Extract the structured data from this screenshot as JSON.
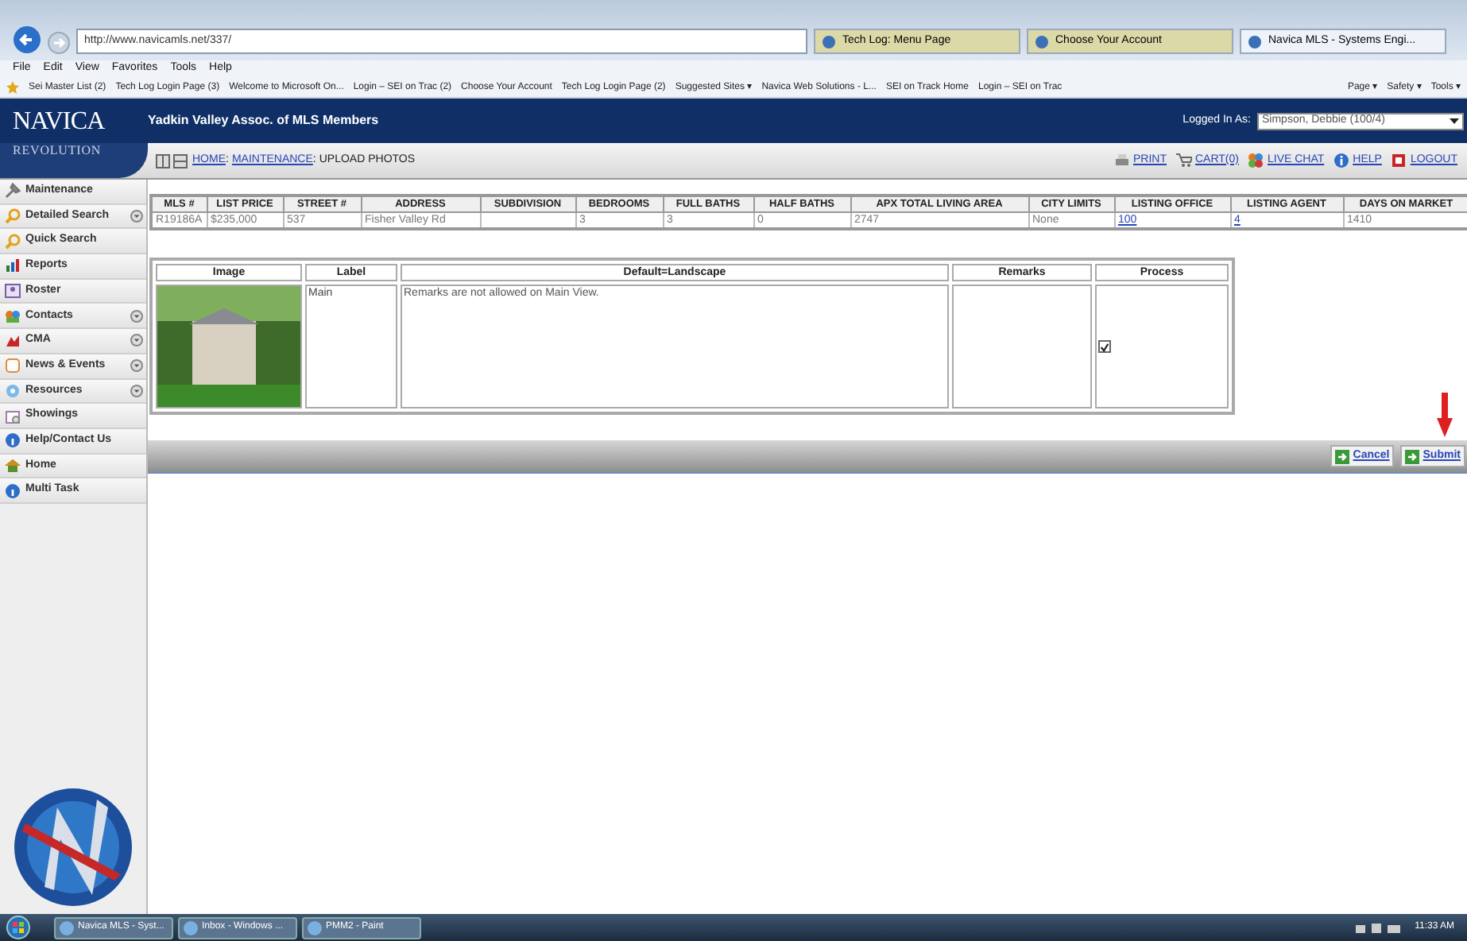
{
  "browser": {
    "address": "http://www.navicamls.net/337/",
    "tabs": [
      {
        "label": "Tech Log: Menu Page",
        "selected": false
      },
      {
        "label": "Choose Your Account",
        "selected": false
      },
      {
        "label": "Navica MLS - Systems Engi...",
        "selected": true
      }
    ],
    "menu": [
      "File",
      "Edit",
      "View",
      "Favorites",
      "Tools",
      "Help"
    ],
    "favorites": [
      "Sei Master List (2)",
      "Tech Log Login Page (3)",
      "Welcome to Microsoft On...",
      "Login – SEI on Trac (2)",
      "Choose Your Account",
      "Tech Log Login Page (2)",
      "Suggested Sites ▾",
      "Navica Web Solutions - L...",
      "SEI on Track Home",
      "Login – SEI on Trac"
    ],
    "commands": [
      "Page ▾",
      "Safety ▾",
      "Tools ▾"
    ]
  },
  "header": {
    "logo_top": "NAVICA",
    "logo_bottom": "REVOLUTION",
    "organization": "Yadkin Valley Assoc. of MLS Members",
    "logged_in_label": "Logged In As:",
    "user": "Simpson, Debbie (100/4)"
  },
  "breadcrumb": {
    "separator": ":",
    "items": [
      {
        "label": "HOME",
        "kind": "link"
      },
      {
        "label": "MAINTENANCE",
        "kind": "link"
      },
      {
        "label": "UPLOAD PHOTOS",
        "kind": "current"
      }
    ]
  },
  "top_links": [
    "PRINT",
    "CART(0)",
    "LIVE CHAT",
    "HELP",
    "LOGOUT"
  ],
  "sidebar": {
    "items": [
      {
        "label": "Maintenance",
        "expandable": false
      },
      {
        "label": "Detailed Search",
        "expandable": true
      },
      {
        "label": "Quick Search",
        "expandable": false
      },
      {
        "label": "Reports",
        "expandable": false
      },
      {
        "label": "Roster",
        "expandable": false
      },
      {
        "label": "Contacts",
        "expandable": true
      },
      {
        "label": "CMA",
        "expandable": true
      },
      {
        "label": "News & Events",
        "expandable": true
      },
      {
        "label": "Resources",
        "expandable": true
      },
      {
        "label": "Showings",
        "expandable": false
      },
      {
        "label": "Help/Contact Us",
        "expandable": false
      },
      {
        "label": "Home",
        "expandable": false
      },
      {
        "label": "Multi Task",
        "expandable": false
      }
    ]
  },
  "listing": {
    "columns": [
      "MLS #",
      "LIST PRICE",
      "STREET #",
      "ADDRESS",
      "SUBDIVISION",
      "BEDROOMS",
      "FULL BATHS",
      "HALF BATHS",
      "APX TOTAL LIVING AREA",
      "CITY LIMITS",
      "LISTING OFFICE",
      "LISTING AGENT",
      "DAYS ON MARKET"
    ],
    "rows": [
      [
        {
          "text": "R19186A",
          "kind": "text"
        },
        {
          "text": "$235,000",
          "kind": "text"
        },
        {
          "text": "537",
          "kind": "text"
        },
        {
          "text": "Fisher Valley Rd",
          "kind": "text"
        },
        null,
        {
          "text": "3",
          "kind": "text"
        },
        {
          "text": "3",
          "kind": "text"
        },
        {
          "text": "0",
          "kind": "text"
        },
        {
          "text": "2747",
          "kind": "text"
        },
        {
          "text": "None",
          "kind": "text"
        },
        {
          "text": "100",
          "kind": "link"
        },
        {
          "text": "4",
          "kind": "link"
        },
        {
          "text": "1410",
          "kind": "text"
        }
      ]
    ]
  },
  "photos": {
    "columns": [
      "Image",
      "Label",
      "Default=Landscape",
      "Remarks",
      "Process"
    ],
    "rows": [
      {
        "label": "Main",
        "note": "Remarks are not allowed on Main View.",
        "process": true
      }
    ]
  },
  "buttons": [
    "Cancel",
    "Submit"
  ],
  "taskbar": {
    "items": [
      "Navica MLS - Syst...",
      "Inbox - Windows ...",
      "PMM2 - Paint"
    ],
    "time": "11:33 AM"
  }
}
